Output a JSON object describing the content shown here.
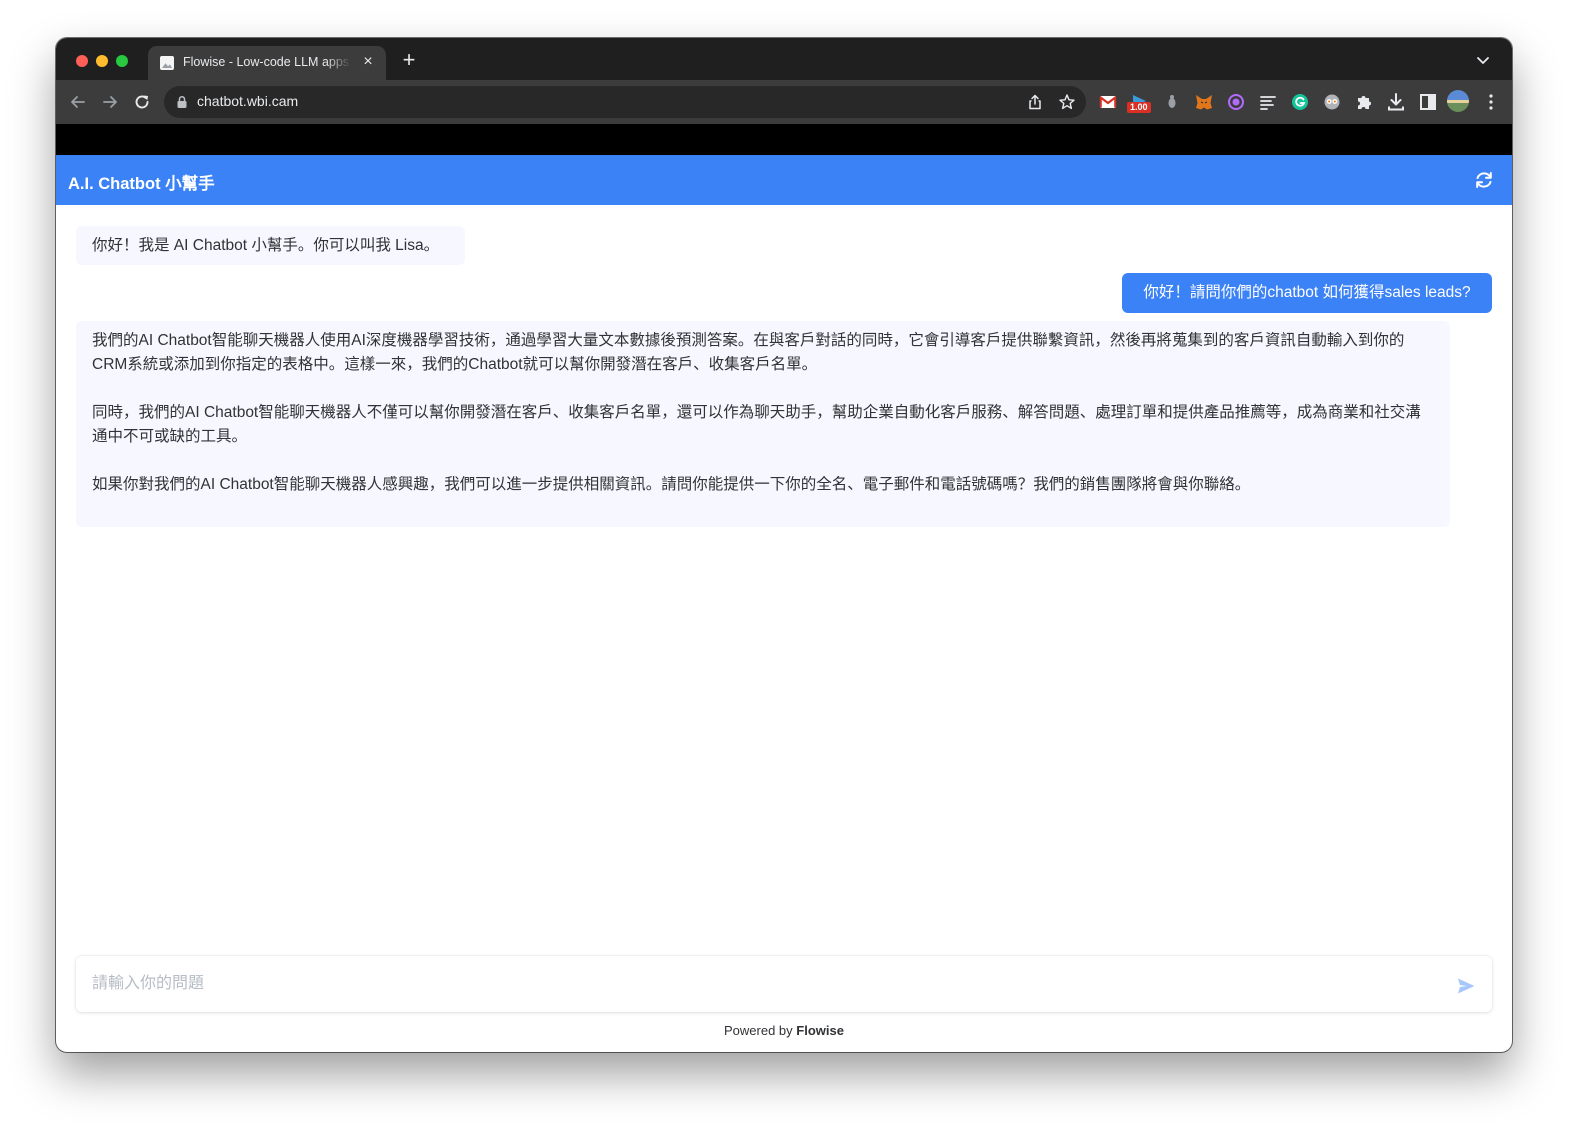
{
  "browser": {
    "tab_title": "Flowise - Low-code LLM apps builder",
    "url": "chatbot.wbi.cam",
    "extension_badge": "1.00",
    "tab_close": "×",
    "new_tab": "+"
  },
  "header": {
    "title": "A.I. Chatbot 小幫手"
  },
  "messages": [
    {
      "role": "bot",
      "text": "你好！我是 AI Chatbot 小幫手。你可以叫我 Lisa。"
    },
    {
      "role": "user",
      "text": "你好！請問你們的chatbot 如何獲得sales leads?"
    },
    {
      "role": "bot",
      "paragraphs": [
        "我們的AI Chatbot智能聊天機器人使用AI深度機器學習技術，通過學習大量文本數據後預測答案。在與客戶對話的同時，它會引導客戶提供聯繫資訊，然後再將蒐集到的客戶資訊自動輸入到你的CRM系統或添加到你指定的表格中。這樣一來，我們的Chatbot就可以幫你開發潛在客戶、收集客戶名單。",
        "同時，我們的AI Chatbot智能聊天機器人不僅可以幫你開發潛在客戶、收集客戶名單，還可以作為聊天助手，幫助企業自動化客戶服務、解答問題、處理訂單和提供產品推薦等，成為商業和社交溝通中不可或缺的工具。",
        "如果你對我們的AI Chatbot智能聊天機器人感興趣，我們可以進一步提供相關資訊。請問你能提供一下你的全名、電子郵件和電話號碼嗎？我們的銷售團隊將會與你聯絡。"
      ]
    }
  ],
  "input": {
    "placeholder": "請輸入你的問題",
    "value": ""
  },
  "footer": {
    "powered_prefix": "Powered by",
    "brand": "Flowise"
  },
  "colors": {
    "header": "#3b82f6",
    "user_bubble": "#3b82f6",
    "bot_bubble": "#f7f8ff",
    "send_icon": "#3b82f6"
  },
  "icons": [
    "back-arrow-icon",
    "forward-arrow-icon",
    "reload-icon",
    "lock-icon",
    "share-icon",
    "bookmark-star-icon",
    "gmail-icon",
    "extensions-puzzle-icon",
    "download-icon",
    "side-panel-icon",
    "profile-avatar",
    "kebab-menu-icon",
    "refresh-icon",
    "send-icon"
  ]
}
